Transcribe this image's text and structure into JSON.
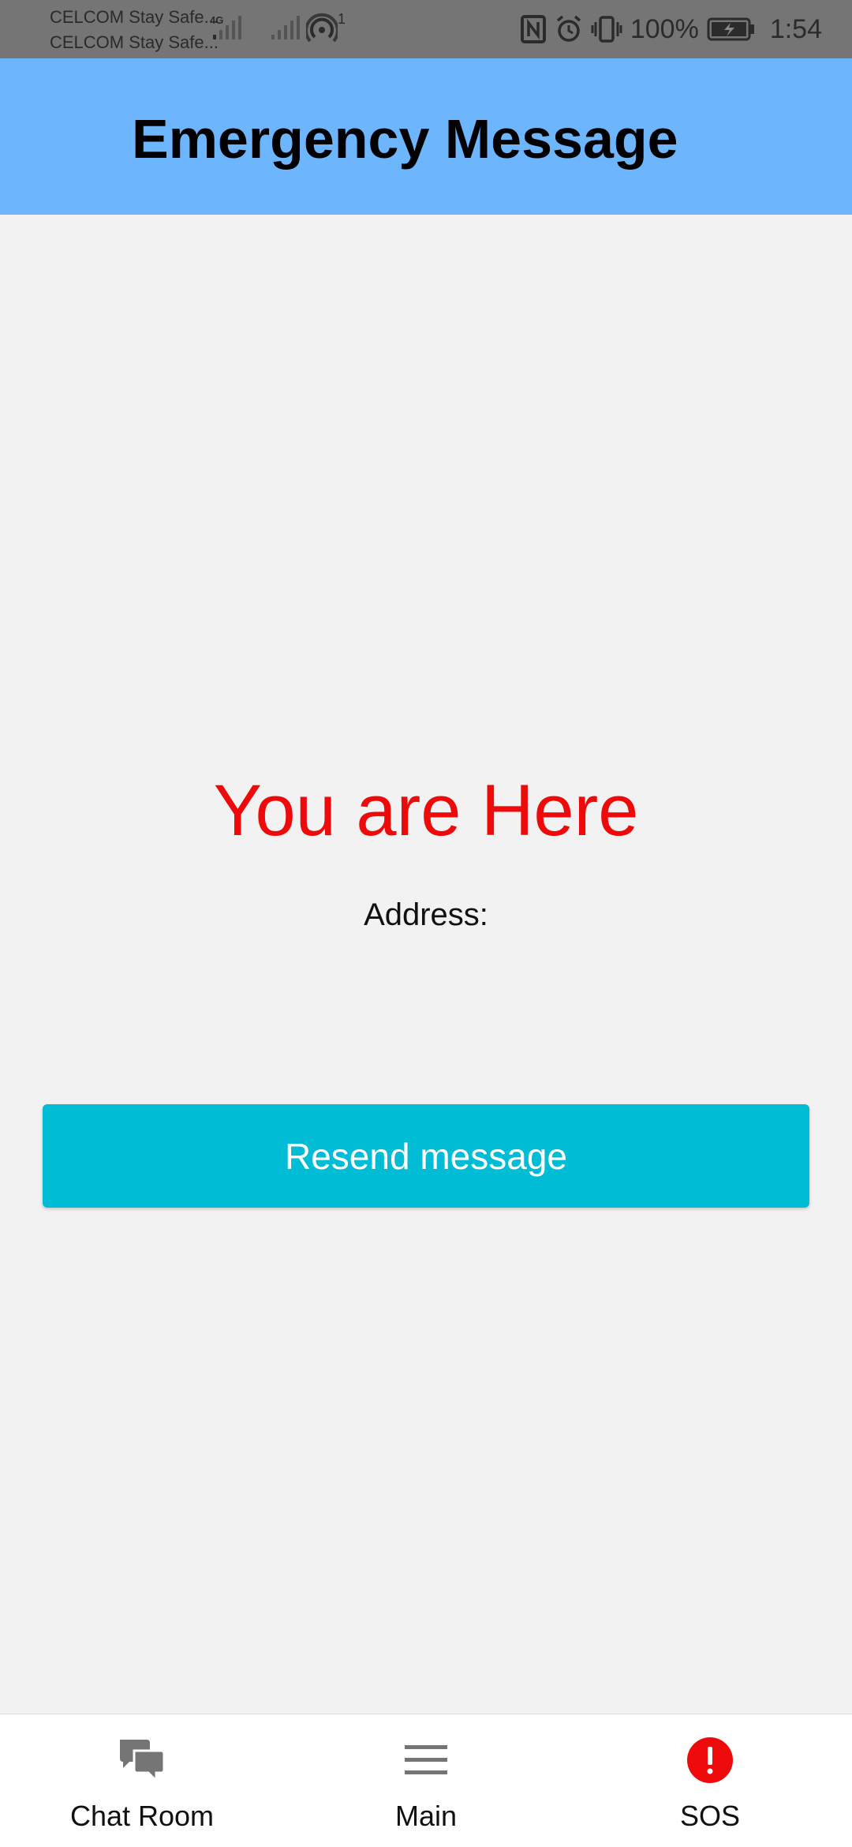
{
  "status_bar": {
    "carrier_1": "CELCOM Stay Safe...",
    "carrier_2": "CELCOM Stay Safe...",
    "network_type": "4G",
    "hotspot_count": "1",
    "battery_percent": "100%",
    "time": "1:54"
  },
  "app_bar": {
    "title": "Emergency Message",
    "background_color": "#6db6fd"
  },
  "content": {
    "location_title": "You are Here",
    "location_title_color": "#ee0a0a",
    "address_label": "Address:"
  },
  "actions": {
    "resend_label": "Resend message",
    "resend_color": "#00bcd4"
  },
  "bottom_nav": {
    "items": [
      {
        "label": "Chat Room",
        "icon": "chat-bubbles-icon"
      },
      {
        "label": "Main",
        "icon": "menu-icon"
      },
      {
        "label": "SOS",
        "icon": "alert-icon",
        "color": "#ee0a0a"
      }
    ]
  }
}
